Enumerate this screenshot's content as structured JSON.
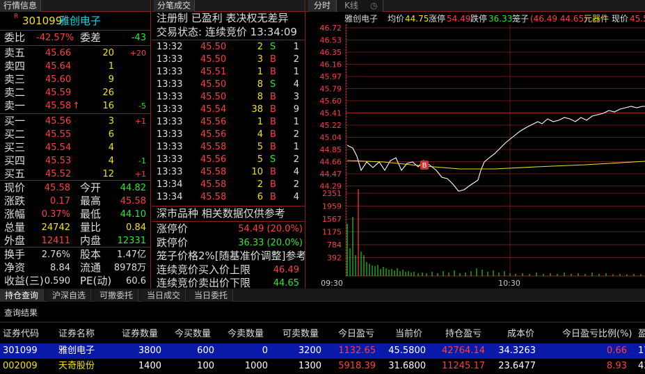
{
  "left": {
    "tab": "行情信息",
    "code": "301099",
    "name": "雅创电子",
    "badge": "R",
    "weibi_label": "委比",
    "weibi": "-42.57%",
    "weicha_label": "委差",
    "weicha": "-43",
    "sells": [
      {
        "label": "卖五",
        "price": "45.66",
        "vol": "20",
        "chg": "+20"
      },
      {
        "label": "卖四",
        "price": "45.64",
        "vol": "1",
        "chg": ""
      },
      {
        "label": "卖三",
        "price": "45.60",
        "vol": "9",
        "chg": ""
      },
      {
        "label": "卖二",
        "price": "45.59",
        "vol": "26",
        "chg": ""
      },
      {
        "label": "卖一",
        "price": "45.58",
        "vol": "16",
        "chg": "-5",
        "arrow": "↑"
      }
    ],
    "buys": [
      {
        "label": "买一",
        "price": "45.56",
        "vol": "3",
        "chg": "+1"
      },
      {
        "label": "买二",
        "price": "45.55",
        "vol": "6",
        "chg": ""
      },
      {
        "label": "买三",
        "price": "45.54",
        "vol": "4",
        "chg": ""
      },
      {
        "label": "买四",
        "price": "45.53",
        "vol": "4",
        "chg": "-1"
      },
      {
        "label": "买五",
        "price": "45.52",
        "vol": "12",
        "chg": "+1"
      }
    ],
    "stats": [
      {
        "l1": "现价",
        "v1": "45.58",
        "c1": "r",
        "l2": "今开",
        "v2": "44.82",
        "c2": "g"
      },
      {
        "l1": "涨跌",
        "v1": "0.17",
        "c1": "r",
        "l2": "最高",
        "v2": "45.58",
        "c2": "r"
      },
      {
        "l1": "涨幅",
        "v1": "0.37%",
        "c1": "r",
        "l2": "最低",
        "v2": "44.10",
        "c2": "g"
      },
      {
        "l1": "总量",
        "v1": "24742",
        "c1": "y",
        "l2": "量比",
        "v2": "0.84",
        "c2": "y"
      },
      {
        "l1": "外盘",
        "v1": "12411",
        "c1": "r",
        "l2": "内盘",
        "v2": "12331",
        "c2": "g"
      }
    ],
    "stats2": [
      {
        "l1": "换手",
        "v1": "2.76%",
        "l2": "股本",
        "v2": "1.47亿"
      },
      {
        "l1": "净资",
        "v1": "8.84",
        "l2": "流通",
        "v2": "8978万"
      },
      {
        "l1": "收益(三)",
        "v1": "0.590",
        "l2": "PE(动)",
        "v2": "60.6"
      }
    ]
  },
  "mid": {
    "tab": "分笔成交",
    "line1": "注册制 已盈利 表决权无差异",
    "line2": "交易状态: 连续竞价 13:34:09",
    "trades": [
      {
        "t": "13:32",
        "p": "45.50",
        "v": "2",
        "d": "S",
        "n": "1"
      },
      {
        "t": "13:33",
        "p": "45.50",
        "v": "3",
        "d": "B",
        "n": "2"
      },
      {
        "t": "13:33",
        "p": "45.51",
        "v": "1",
        "d": "B",
        "n": "1"
      },
      {
        "t": "13:33",
        "p": "45.50",
        "v": "8",
        "d": "S",
        "n": "4"
      },
      {
        "t": "13:33",
        "p": "45.50",
        "v": "8",
        "d": "B",
        "n": "3"
      },
      {
        "t": "13:33",
        "p": "45.54",
        "v": "38",
        "d": "B",
        "n": "9"
      },
      {
        "t": "13:33",
        "p": "45.56",
        "v": "1",
        "d": "B",
        "n": "1"
      },
      {
        "t": "13:33",
        "p": "45.56",
        "v": "4",
        "d": "B",
        "n": "2"
      },
      {
        "t": "13:33",
        "p": "45.58",
        "v": "5",
        "d": "B",
        "n": "1"
      },
      {
        "t": "13:33",
        "p": "45.56",
        "v": "5",
        "d": "S",
        "n": "2"
      },
      {
        "t": "13:33",
        "p": "45.58",
        "v": "10",
        "d": "B",
        "n": "4"
      },
      {
        "t": "13:34",
        "p": "45.58",
        "v": "2",
        "d": "B",
        "n": "2"
      },
      {
        "t": "13:34",
        "p": "45.58",
        "v": "6",
        "d": "B",
        "n": "4"
      }
    ],
    "note_title": "深市品种  相关数据仅供参考",
    "limit_up_label": "涨停价",
    "limit_up": "54.49 (20.0%)",
    "limit_down_label": "跌停价",
    "limit_down": "36.33 (20.0%)",
    "cage_label": "笼子价格2%[随基准价调整]参考",
    "auction_buy_label": "连续竞价买入价上限",
    "auction_buy": "46.49",
    "auction_sell_label": "连续竞价卖出价下限",
    "auction_sell": "44.65"
  },
  "chart": {
    "tab_active": "分时",
    "tab2": "K线",
    "hdr_name": "雅创电子",
    "avg_label": "均价",
    "avg": "44.75",
    "up_label": "涨停",
    "up": "54.49",
    "down_label": "跌停",
    "down": "36.33",
    "cage_label": "笼子",
    "cage": "(46.49 44.65)",
    "sector": "元器件",
    "now_label": "现价",
    "now": "45.5",
    "price_ticks": [
      "46.72",
      "46.53",
      "46.35",
      "46.16",
      "45.97",
      "45.79",
      "45.60",
      "45.41",
      "45.22",
      "45.04",
      "44.85",
      "44.66",
      "44.47",
      "44.29"
    ],
    "vol_ticks": [
      "2351",
      "1959",
      "1567",
      "1175",
      "784",
      "392"
    ],
    "time_ticks": [
      "09:30",
      "10:30"
    ],
    "marker": "B",
    "colors": {
      "price": "#ffffff",
      "avg": "#e8e020",
      "grid": "#8a2020",
      "volume": "#20d020"
    }
  },
  "bottom": {
    "tabs": [
      "持仓查询",
      "沪深自选",
      "可撤委托",
      "当日成交",
      "当日委托"
    ],
    "title": "查询结果",
    "headers": [
      "证券代码",
      "证券名称",
      "证券数量",
      "今买数量",
      "今卖数量",
      "可卖数量",
      "今日盈亏",
      "当前价",
      "持仓盈亏",
      "成本价",
      "今日盈亏比例(%)",
      "盈"
    ],
    "rows": [
      [
        "301099",
        "雅创电子",
        "3800",
        "600",
        "0",
        "3200",
        "1132.65",
        "45.5800",
        "42764.14",
        "34.3263",
        "0.66",
        "17"
      ],
      [
        "002009",
        "天奇股份",
        "1400",
        "100",
        "1000",
        "1300",
        "5918.39",
        "31.6800",
        "11245.17",
        "23.6477",
        "8.93",
        "43"
      ]
    ]
  }
}
